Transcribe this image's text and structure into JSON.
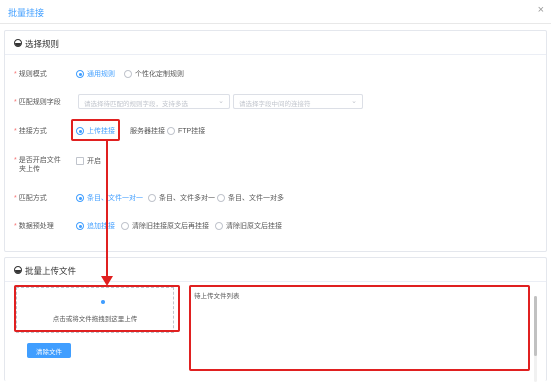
{
  "dialog": {
    "title": "批量挂接",
    "close_glyph": "×"
  },
  "rules_section": {
    "title": "选择规则"
  },
  "rule_mode": {
    "label": "规则模式",
    "options": [
      "通用规则",
      "个性化定制规则"
    ],
    "selected": "通用规则"
  },
  "match_fields": {
    "label": "匹配规则字段",
    "select1_placeholder": "请选择待匹配的规则字段，支持多选",
    "select2_placeholder": "请选择字段中间的连接符"
  },
  "attach_method": {
    "label": "挂接方式",
    "options": [
      "上传挂接",
      "服务器挂接",
      "FTP挂接"
    ],
    "selected": "上传挂接"
  },
  "folder_upload": {
    "label_line1": "是否开启文件",
    "label_line2": "夹上传",
    "checkbox_label": "开启"
  },
  "match_method": {
    "label": "匹配方式",
    "options": [
      "条目、文件一对一",
      "条目、文件多对一",
      "条目、文件一对多"
    ],
    "selected": "条目、文件一对一"
  },
  "preprocess": {
    "label": "数据预处理",
    "options": [
      "追加挂接",
      "清除旧挂接原文后再挂接",
      "清除旧原文后挂接"
    ],
    "selected": "追加挂接"
  },
  "upload_section": {
    "title": "批量上传文件"
  },
  "upload": {
    "area_text": "点击或将文件拖拽到这里上传",
    "file_list_title": "待上传文件列表",
    "clear_button": "清除文件"
  },
  "colors": {
    "accent": "#409eff",
    "annotation": "#e02020",
    "required": "#f56c6c"
  }
}
